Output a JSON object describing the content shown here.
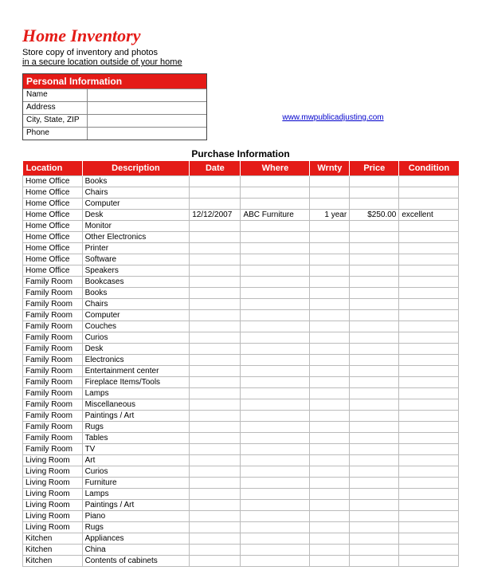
{
  "title": "Home Inventory",
  "subtitle1": "Store copy of inventory and photos",
  "subtitle2": "in a secure location outside of your home",
  "personal": {
    "header": "Personal Information",
    "fields": [
      "Name",
      "Address",
      "City, State, ZIP",
      "Phone"
    ]
  },
  "link": "www.mwpublicadjusting.com",
  "purchase_section_title": "Purchase Information",
  "columns": {
    "location": "Location",
    "description": "Description",
    "date": "Date",
    "where": "Where",
    "wrnty": "Wrnty",
    "price": "Price",
    "condition": "Condition"
  },
  "rows": [
    {
      "location": "Home Office",
      "description": "Books",
      "date": "",
      "where": "",
      "wrnty": "",
      "price": "",
      "condition": ""
    },
    {
      "location": "Home Office",
      "description": "Chairs",
      "date": "",
      "where": "",
      "wrnty": "",
      "price": "",
      "condition": ""
    },
    {
      "location": "Home Office",
      "description": "Computer",
      "date": "",
      "where": "",
      "wrnty": "",
      "price": "",
      "condition": ""
    },
    {
      "location": "Home Office",
      "description": "Desk",
      "date": "12/12/2007",
      "where": "ABC Furniture",
      "wrnty": "1 year",
      "price": "$250.00",
      "condition": "excellent"
    },
    {
      "location": "Home Office",
      "description": "Monitor",
      "date": "",
      "where": "",
      "wrnty": "",
      "price": "",
      "condition": ""
    },
    {
      "location": "Home Office",
      "description": "Other Electronics",
      "date": "",
      "where": "",
      "wrnty": "",
      "price": "",
      "condition": ""
    },
    {
      "location": "Home Office",
      "description": "Printer",
      "date": "",
      "where": "",
      "wrnty": "",
      "price": "",
      "condition": ""
    },
    {
      "location": "Home Office",
      "description": "Software",
      "date": "",
      "where": "",
      "wrnty": "",
      "price": "",
      "condition": ""
    },
    {
      "location": "Home Office",
      "description": "Speakers",
      "date": "",
      "where": "",
      "wrnty": "",
      "price": "",
      "condition": ""
    },
    {
      "location": "Family Room",
      "description": "Bookcases",
      "date": "",
      "where": "",
      "wrnty": "",
      "price": "",
      "condition": ""
    },
    {
      "location": "Family Room",
      "description": "Books",
      "date": "",
      "where": "",
      "wrnty": "",
      "price": "",
      "condition": ""
    },
    {
      "location": "Family Room",
      "description": "Chairs",
      "date": "",
      "where": "",
      "wrnty": "",
      "price": "",
      "condition": ""
    },
    {
      "location": "Family Room",
      "description": "Computer",
      "date": "",
      "where": "",
      "wrnty": "",
      "price": "",
      "condition": ""
    },
    {
      "location": "Family Room",
      "description": "Couches",
      "date": "",
      "where": "",
      "wrnty": "",
      "price": "",
      "condition": ""
    },
    {
      "location": "Family Room",
      "description": "Curios",
      "date": "",
      "where": "",
      "wrnty": "",
      "price": "",
      "condition": ""
    },
    {
      "location": "Family Room",
      "description": "Desk",
      "date": "",
      "where": "",
      "wrnty": "",
      "price": "",
      "condition": ""
    },
    {
      "location": "Family Room",
      "description": "Electronics",
      "date": "",
      "where": "",
      "wrnty": "",
      "price": "",
      "condition": ""
    },
    {
      "location": "Family Room",
      "description": "Entertainment center",
      "date": "",
      "where": "",
      "wrnty": "",
      "price": "",
      "condition": ""
    },
    {
      "location": "Family Room",
      "description": "Fireplace Items/Tools",
      "date": "",
      "where": "",
      "wrnty": "",
      "price": "",
      "condition": ""
    },
    {
      "location": "Family Room",
      "description": "Lamps",
      "date": "",
      "where": "",
      "wrnty": "",
      "price": "",
      "condition": ""
    },
    {
      "location": "Family Room",
      "description": "Miscellaneous",
      "date": "",
      "where": "",
      "wrnty": "",
      "price": "",
      "condition": ""
    },
    {
      "location": "Family Room",
      "description": "Paintings / Art",
      "date": "",
      "where": "",
      "wrnty": "",
      "price": "",
      "condition": ""
    },
    {
      "location": "Family Room",
      "description": "Rugs",
      "date": "",
      "where": "",
      "wrnty": "",
      "price": "",
      "condition": ""
    },
    {
      "location": "Family Room",
      "description": "Tables",
      "date": "",
      "where": "",
      "wrnty": "",
      "price": "",
      "condition": ""
    },
    {
      "location": "Family Room",
      "description": "TV",
      "date": "",
      "where": "",
      "wrnty": "",
      "price": "",
      "condition": ""
    },
    {
      "location": "Living Room",
      "description": "Art",
      "date": "",
      "where": "",
      "wrnty": "",
      "price": "",
      "condition": ""
    },
    {
      "location": "Living Room",
      "description": "Curios",
      "date": "",
      "where": "",
      "wrnty": "",
      "price": "",
      "condition": ""
    },
    {
      "location": "Living Room",
      "description": "Furniture",
      "date": "",
      "where": "",
      "wrnty": "",
      "price": "",
      "condition": ""
    },
    {
      "location": "Living Room",
      "description": "Lamps",
      "date": "",
      "where": "",
      "wrnty": "",
      "price": "",
      "condition": ""
    },
    {
      "location": "Living Room",
      "description": "Paintings / Art",
      "date": "",
      "where": "",
      "wrnty": "",
      "price": "",
      "condition": ""
    },
    {
      "location": "Living Room",
      "description": "Piano",
      "date": "",
      "where": "",
      "wrnty": "",
      "price": "",
      "condition": ""
    },
    {
      "location": "Living Room",
      "description": "Rugs",
      "date": "",
      "where": "",
      "wrnty": "",
      "price": "",
      "condition": ""
    },
    {
      "location": "Kitchen",
      "description": "Appliances",
      "date": "",
      "where": "",
      "wrnty": "",
      "price": "",
      "condition": ""
    },
    {
      "location": "Kitchen",
      "description": "China",
      "date": "",
      "where": "",
      "wrnty": "",
      "price": "",
      "condition": ""
    },
    {
      "location": "Kitchen",
      "description": "Contents of cabinets",
      "date": "",
      "where": "",
      "wrnty": "",
      "price": "",
      "condition": ""
    }
  ]
}
